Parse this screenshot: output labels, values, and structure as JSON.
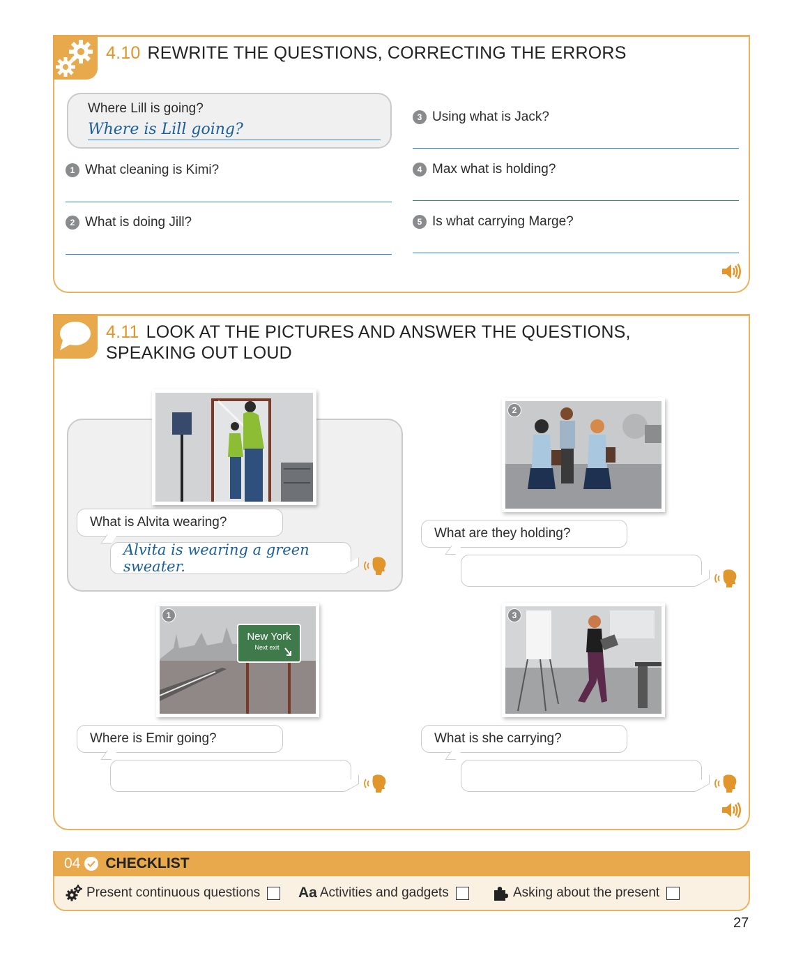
{
  "ex410": {
    "number": "4.10",
    "title": "REWRITE THE QUESTIONS, CORRECTING THE ERRORS",
    "example_question": "Where Lill is going?",
    "example_answer": "Where is Lill going?",
    "items": [
      {
        "num": "1",
        "text": "What cleaning is Kimi?"
      },
      {
        "num": "2",
        "text": "What is doing Jill?"
      },
      {
        "num": "3",
        "text": "Using what is Jack?"
      },
      {
        "num": "4",
        "text": "Max what is holding?"
      },
      {
        "num": "5",
        "text": "Is what carrying Marge?"
      }
    ]
  },
  "ex411": {
    "number": "4.11",
    "title_line1": "LOOK AT THE PICTURES AND ANSWER THE QUESTIONS,",
    "title_line2": "SPEAKING OUT LOUD",
    "example_question": "What is Alvita wearing?",
    "example_answer": "Alvita is wearing a green sweater.",
    "items": [
      {
        "num": "1",
        "question": "Where is Emir going?",
        "sign_title": "New York",
        "sign_sub": "Next exit"
      },
      {
        "num": "2",
        "question": "What are they holding?"
      },
      {
        "num": "3",
        "question": "What is she carrying?"
      }
    ]
  },
  "checklist": {
    "unit": "04",
    "title": "CHECKLIST",
    "items": [
      {
        "label": "Present continuous questions",
        "icon": "gears-icon"
      },
      {
        "label": "Activities and gadgets",
        "icon": "Aa",
        "icon_text": "Aa"
      },
      {
        "label": "Asking about the present",
        "icon": "puzzle-icon"
      }
    ]
  },
  "page_number": "27",
  "colors": {
    "accent": "#e8a94c",
    "line_blue": "#2a84c4",
    "answer_blue": "#1b5f9a",
    "panel_gray": "#f0f0f1"
  }
}
